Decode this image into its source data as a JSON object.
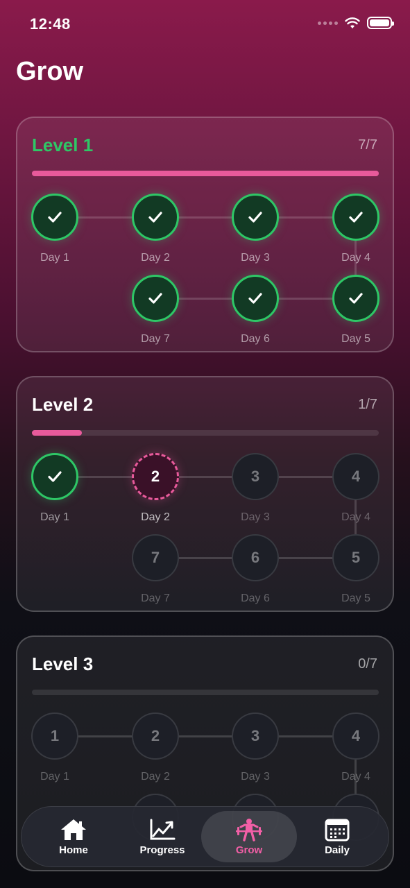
{
  "status_bar": {
    "time": "12:48"
  },
  "page": {
    "title": "Grow"
  },
  "levels": [
    {
      "title": "Level 1",
      "count": "7/7",
      "progress": 1.0,
      "days": [
        {
          "number": "1",
          "label": "Day 1",
          "state": "done"
        },
        {
          "number": "2",
          "label": "Day 2",
          "state": "done"
        },
        {
          "number": "3",
          "label": "Day 3",
          "state": "done"
        },
        {
          "number": "4",
          "label": "Day 4",
          "state": "done"
        },
        {
          "number": "5",
          "label": "Day 5",
          "state": "done"
        },
        {
          "number": "6",
          "label": "Day 6",
          "state": "done"
        },
        {
          "number": "7",
          "label": "Day 7",
          "state": "done"
        }
      ]
    },
    {
      "title": "Level 2",
      "count": "1/7",
      "progress": 0.143,
      "days": [
        {
          "number": "1",
          "label": "Day 1",
          "state": "done"
        },
        {
          "number": "2",
          "label": "Day 2",
          "state": "current"
        },
        {
          "number": "3",
          "label": "Day 3",
          "state": "locked"
        },
        {
          "number": "4",
          "label": "Day 4",
          "state": "locked"
        },
        {
          "number": "5",
          "label": "Day 5",
          "state": "locked"
        },
        {
          "number": "6",
          "label": "Day 6",
          "state": "locked"
        },
        {
          "number": "7",
          "label": "Day 7",
          "state": "locked"
        }
      ]
    },
    {
      "title": "Level 3",
      "count": "0/7",
      "progress": 0.0,
      "days": [
        {
          "number": "1",
          "label": "Day 1",
          "state": "locked"
        },
        {
          "number": "2",
          "label": "Day 2",
          "state": "locked"
        },
        {
          "number": "3",
          "label": "Day 3",
          "state": "locked"
        },
        {
          "number": "4",
          "label": "Day 4",
          "state": "locked"
        }
      ]
    }
  ],
  "tab_bar": {
    "selected": "Grow",
    "items": [
      {
        "label": "Home",
        "icon": "home-icon"
      },
      {
        "label": "Progress",
        "icon": "chart-line-icon"
      },
      {
        "label": "Grow",
        "icon": "weightlifter-icon"
      },
      {
        "label": "Daily",
        "icon": "calendar-icon"
      }
    ]
  },
  "colors": {
    "accent": "#e85a9b",
    "complete": "#2ec766",
    "grow_tab": "#f25fa6"
  }
}
